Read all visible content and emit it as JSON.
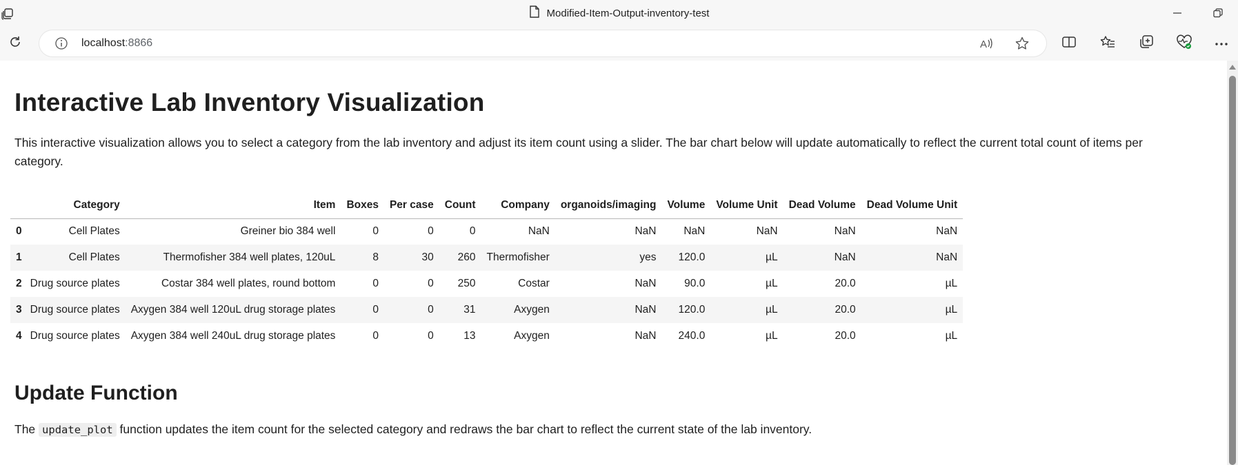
{
  "window": {
    "title": "Modified-Item-Output-inventory-test"
  },
  "address": {
    "host": "localhost",
    "port": ":8866"
  },
  "page": {
    "title": "Interactive Lab Inventory Visualization",
    "intro": "This interactive visualization allows you to select a category from the lab inventory and adjust its item count using a slider. The bar chart below will update automatically to reflect the current total count of items per category.",
    "section_title": "Update Function",
    "desc_before": "The ",
    "desc_code": "update_plot",
    "desc_after": " function updates the item count for the selected category and redraws the bar chart to reflect the current state of the lab inventory."
  },
  "table": {
    "columns": [
      "",
      "Category",
      "Item",
      "Boxes",
      "Per case",
      "Count",
      "Company",
      "organoids/imaging",
      "Volume",
      "Volume Unit",
      "Dead Volume",
      "Dead Volume Unit"
    ],
    "rows": [
      [
        "0",
        "Cell Plates",
        "Greiner bio 384 well",
        "0",
        "0",
        "0",
        "NaN",
        "NaN",
        "NaN",
        "NaN",
        "NaN",
        "NaN"
      ],
      [
        "1",
        "Cell Plates",
        "Thermofisher 384 well plates, 120uL",
        "8",
        "30",
        "260",
        "Thermofisher",
        "yes",
        "120.0",
        "µL",
        "NaN",
        "NaN"
      ],
      [
        "2",
        "Drug source plates",
        "Costar 384 well plates, round bottom",
        "0",
        "0",
        "250",
        "Costar",
        "NaN",
        "90.0",
        "µL",
        "20.0",
        "µL"
      ],
      [
        "3",
        "Drug source plates",
        "Axygen 384 well 120uL drug storage plates",
        "0",
        "0",
        "31",
        "Axygen",
        "NaN",
        "120.0",
        "µL",
        "20.0",
        "µL"
      ],
      [
        "4",
        "Drug source plates",
        "Axygen 384 well 240uL drug storage plates",
        "0",
        "0",
        "13",
        "Axygen",
        "NaN",
        "240.0",
        "µL",
        "20.0",
        "µL"
      ]
    ]
  },
  "icons": {
    "app": "tab-actions-icon",
    "page": "document-icon",
    "refresh": "refresh-icon",
    "info": "info-icon",
    "read_aloud": "read-aloud-icon",
    "favorite": "star-icon",
    "split": "split-screen-icon",
    "favorites": "favorites-icon",
    "collections": "collections-icon",
    "health": "browser-essentials-icon",
    "more": "more-icon"
  },
  "colors": {
    "health_badge": "#1a9c3e"
  }
}
